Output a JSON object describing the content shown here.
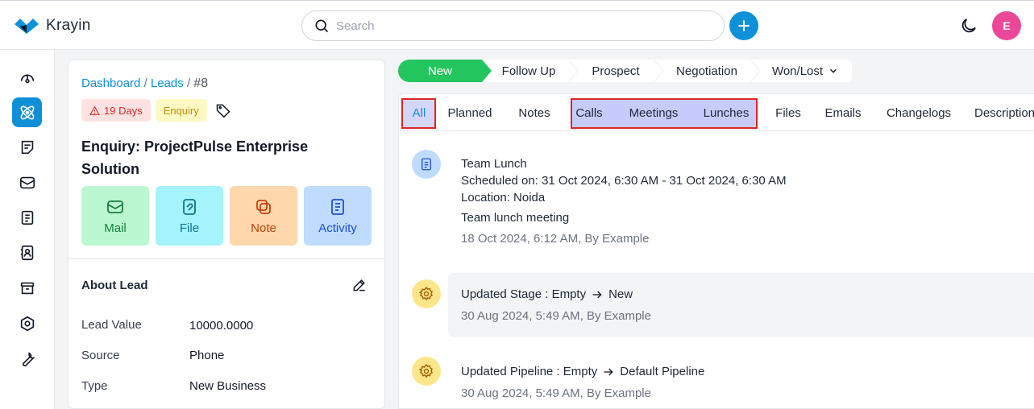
{
  "header": {
    "logo_text": "Krayin",
    "search_placeholder": "Search",
    "avatar_initial": "E",
    "colors": {
      "primary": "#0e90d9",
      "avatar": "#ec4899"
    }
  },
  "sidebar": {
    "items": [
      {
        "icon": "dashboard-icon"
      },
      {
        "icon": "leads-icon",
        "active": true
      },
      {
        "icon": "quotes-icon"
      },
      {
        "icon": "mail-icon"
      },
      {
        "icon": "activities-icon"
      },
      {
        "icon": "contacts-icon"
      },
      {
        "icon": "products-icon"
      },
      {
        "icon": "settings-icon"
      },
      {
        "icon": "configuration-icon"
      }
    ]
  },
  "lead": {
    "breadcrumb": {
      "dashboard": "Dashboard",
      "leads": "Leads",
      "sep": "/",
      "id": "#8"
    },
    "tags": {
      "days": "19 Days",
      "type": "Enquiry"
    },
    "title": "Enquiry: ProjectPulse Enterprise Solution",
    "actions": {
      "mail": "Mail",
      "file": "File",
      "note": "Note",
      "activity": "Activity"
    },
    "about_title": "About Lead",
    "attributes": [
      {
        "label": "Lead Value",
        "value": "10000.0000"
      },
      {
        "label": "Source",
        "value": "Phone"
      },
      {
        "label": "Type",
        "value": "New Business"
      }
    ]
  },
  "stages": [
    "New",
    "Follow Up",
    "Prospect",
    "Negotiation",
    "Won/Lost"
  ],
  "tabs": [
    "All",
    "Planned",
    "Notes",
    "Calls",
    "Meetings",
    "Lunches",
    "Files",
    "Emails",
    "Changelogs",
    "Description"
  ],
  "activities": [
    {
      "title": "Team Lunch",
      "scheduled": "Scheduled on: 31 Oct 2024, 6:30 AM - 31 Oct 2024, 6:30 AM",
      "location": "Location: Noida",
      "comment": "Team lunch meeting",
      "meta": "18 Oct 2024, 6:12 AM, By Example"
    },
    {
      "title_prefix": "Updated Stage : Empty",
      "title_to": "New",
      "meta": "30 Aug 2024, 5:49 AM, By Example"
    },
    {
      "title_prefix": "Updated Pipeline : Empty",
      "title_to": "Default Pipeline",
      "meta": "30 Aug 2024, 5:49 AM, By Example"
    }
  ]
}
